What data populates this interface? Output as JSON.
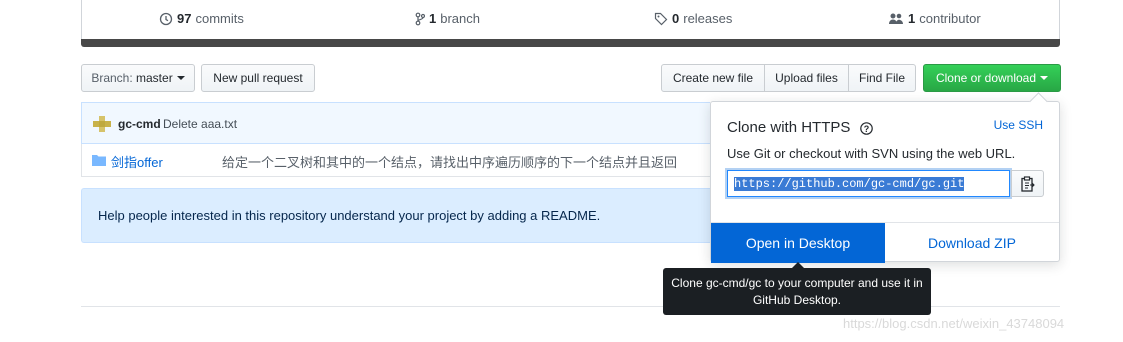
{
  "summary": {
    "commits_count": "97",
    "commits_label": "commits",
    "branch_count": "1",
    "branch_label": "branch",
    "releases_count": "0",
    "releases_label": "releases",
    "contributor_count": "1",
    "contributor_label": "contributor"
  },
  "toolbar": {
    "branch_prefix": "Branch:",
    "branch_name": "master",
    "new_pull_request": "New pull request",
    "create_new_file": "Create new file",
    "upload_files": "Upload files",
    "find_file": "Find File",
    "clone_or_download": "Clone or download"
  },
  "commit": {
    "author": "gc-cmd",
    "message": "Delete aaa.txt"
  },
  "files": [
    {
      "name": "剑指offer",
      "message": "给定一个二叉树和其中的一个结点，请找出中序遍历顺序的下一个结点并且返回"
    }
  ],
  "readme_prompt": "Help people interested in this repository understand your project by adding a README.",
  "clone_panel": {
    "title": "Clone with HTTPS",
    "use_ssh": "Use SSH",
    "description": "Use Git or checkout with SVN using the web URL.",
    "url": "https://github.com/gc-cmd/gc.git",
    "open_in_desktop": "Open in Desktop",
    "download_zip": "Download ZIP"
  },
  "tooltip": "Clone gc-cmd/gc to your computer and use it in GitHub Desktop.",
  "watermark": "https://blog.csdn.net/weixin_43748094",
  "colors": {
    "green_button": "#28a745",
    "blue_primary": "#0366d6",
    "readme_bg": "#dbedff"
  }
}
